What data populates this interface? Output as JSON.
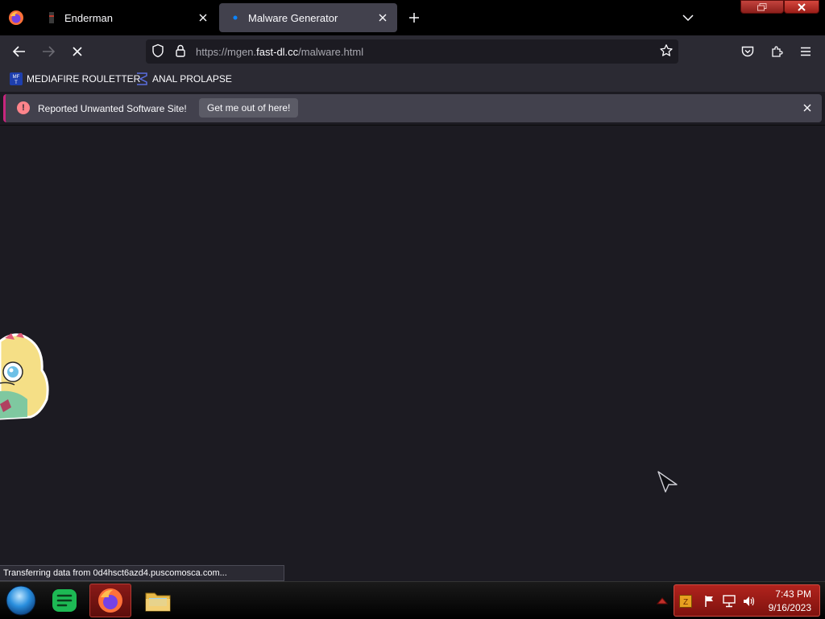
{
  "tabs": [
    {
      "title": "Enderman",
      "active": false
    },
    {
      "title": "Malware Generator",
      "active": true
    }
  ],
  "url": {
    "prefix": "https://mgen.",
    "domain": "fast-dl.cc",
    "path": "/malware.html"
  },
  "bookmarks": [
    {
      "label": "MEDIAFIRE ROULETTER",
      "icon": "mediafire-icon"
    },
    {
      "label": "ANAL PROLAPSE",
      "icon": "sigma-icon"
    }
  ],
  "notification": {
    "message": "Reported Unwanted Software Site!",
    "button_label": "Get me out of here!"
  },
  "status_text": "Transferring data from 0d4hsct6azd4.puscomosca.com...",
  "clock": {
    "time": "7:43 PM",
    "date": "9/16/2023"
  },
  "colors": {
    "notification_accent": "#c7267e",
    "taskbar_tray": "#b1231d",
    "page_bg": "#1c1b22"
  }
}
